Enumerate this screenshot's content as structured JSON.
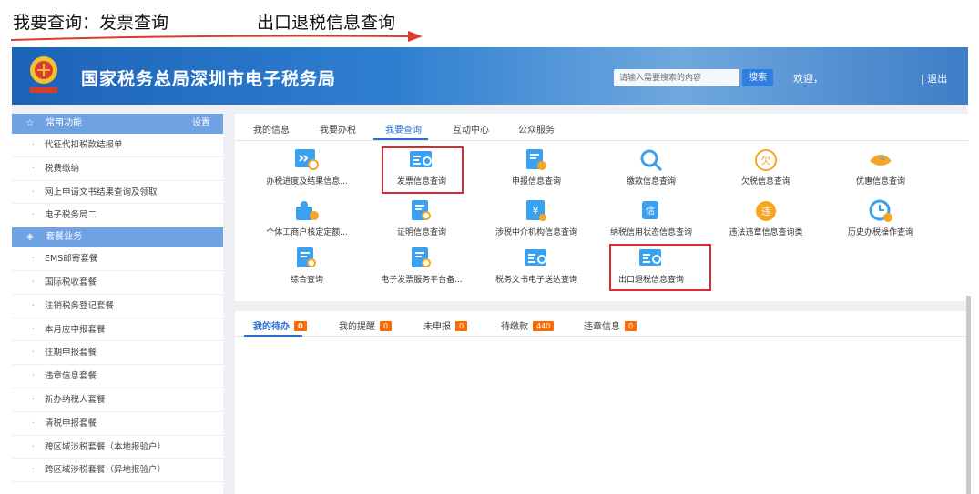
{
  "annotation": {
    "left_text": "我要查询：发票查询",
    "right_text": "出口退税信息查询"
  },
  "header": {
    "title": "国家税务总局深圳市电子税务局",
    "search_placeholder": "请输入需要搜索的内容",
    "search_button": "搜索",
    "welcome": "欢迎，",
    "logout": "| 退出"
  },
  "sidebar": {
    "common_title": "常用功能",
    "settings": "设置",
    "common_items": [
      "代征代扣税款结报单",
      "税费缴纳",
      "网上申请文书结果查询及领取",
      "电子税务局二"
    ],
    "package_title": "套餐业务",
    "package_items": [
      "EMS邮寄套餐",
      "国际税收套餐",
      "注销税务登记套餐",
      "本月应申报套餐",
      "往期申报套餐",
      "违章信息套餐",
      "新办纳税人套餐",
      "清税申报套餐",
      "跨区域涉税套餐（本地报验户）",
      "跨区域涉税套餐（异地报验户）"
    ]
  },
  "tabs": [
    "我的信息",
    "我要办税",
    "我要查询",
    "互动中心",
    "公众服务"
  ],
  "active_tab": "我要查询",
  "tiles": [
    {
      "label": "办税进度及结果信息...",
      "icon": "progress-search-icon"
    },
    {
      "label": "发票信息查询",
      "icon": "invoice-search-icon"
    },
    {
      "label": "申报信息查询",
      "icon": "declaration-upload-icon"
    },
    {
      "label": "缴款信息查询",
      "icon": "magnifier-icon"
    },
    {
      "label": "欠税信息查询",
      "icon": "owed-tax-icon"
    },
    {
      "label": "优惠信息查询",
      "icon": "discount-percent-icon"
    },
    {
      "label": "个体工商户核定定额...",
      "icon": "individual-business-icon"
    },
    {
      "label": "证明信息查询",
      "icon": "certificate-search-icon"
    },
    {
      "label": "涉税中介机构信息查询",
      "icon": "agency-yuan-icon"
    },
    {
      "label": "纳税信用状态信息查询",
      "icon": "credit-icon"
    },
    {
      "label": "违法违章信息查询类",
      "icon": "violation-icon"
    },
    {
      "label": "历史办税操作查询",
      "icon": "history-clock-icon"
    },
    {
      "label": "综合查询",
      "icon": "comprehensive-search-icon"
    },
    {
      "label": "电子发票服务平台备...",
      "icon": "e-invoice-search-icon"
    },
    {
      "label": "税务文书电子送达查询",
      "icon": "document-delivery-icon"
    },
    {
      "label": "出口退税信息查询",
      "icon": "export-refund-icon"
    }
  ],
  "todo_tabs": [
    {
      "label": "我的待办",
      "count": "0"
    },
    {
      "label": "我的提醒",
      "count": "0"
    },
    {
      "label": "未申报",
      "count": "0"
    },
    {
      "label": "待缴款",
      "count": "440"
    },
    {
      "label": "违章信息",
      "count": "0"
    }
  ],
  "colors": {
    "accent": "#2b6fd6",
    "highlight": "#d92b2b",
    "badge": "#ff6a00",
    "sidebar_header": "#6fa2e3"
  }
}
